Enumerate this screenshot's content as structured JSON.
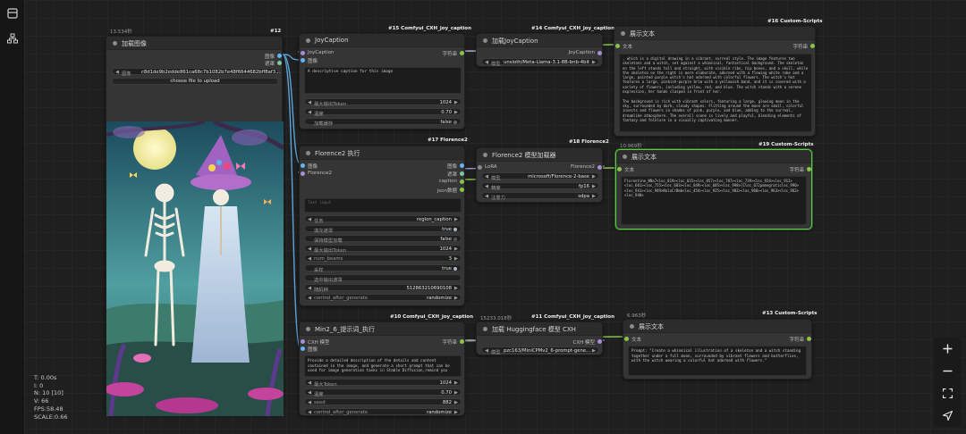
{
  "stats": {
    "t": "T: 0.00s",
    "i": "I: 0",
    "n": "N: 10 [10]",
    "v": "V: 66",
    "fps": "FPS:58.48",
    "scale": "SCALE:0.66"
  },
  "colors": {
    "canvas": "#1f1f1f",
    "node": "#353535",
    "title": "#2c2c2c",
    "image_port": "#64b5f6",
    "string_port": "#8bc34a",
    "model_port": "#b39ddb",
    "selected_border": "#5cc74a",
    "link_blue": "#5ba3d9",
    "link_green": "#8bc34a",
    "link_purple": "#a390d8"
  },
  "icons": {
    "sidebar": [
      "grid-icon",
      "tree-icon"
    ],
    "tools": [
      "plus-icon",
      "minus-icon",
      "fit-view-icon",
      "locate-icon"
    ]
  },
  "nodes": {
    "load_image": {
      "badge": "#12",
      "timer": "13.534秒",
      "title": "加载图像",
      "out_image": "图像",
      "out_mask": "遮罩",
      "image_label": "图像",
      "image_value": "c8d1de9b2edde861ca68c7b1082b7e48f6644682bff8af3...",
      "upload_label": "choose file to upload"
    },
    "joy_caption": {
      "badge": "#15 Comfyui_CXH_joy_caption",
      "title": "JoyCaption",
      "in_joy": "JoyCaption",
      "in_image": "图像",
      "out_string": "字符串",
      "prompt": "A descriptive caption for this image",
      "w_max_token_label": "最大输出Token",
      "w_max_token_value": "1024",
      "w_temp_label": "温度",
      "w_temp_value": "0.70",
      "w_cache_label": "加载缓存",
      "w_cache_value": "false"
    },
    "load_joy": {
      "badge": "#14 Comfyui_CXH_joy_caption",
      "title": "加载JoyCaption",
      "out_joy": "JoyCaption",
      "w_model_label": "模型",
      "w_model_value": "unsloth/Meta-Llama-3.1-8B-bnb-4bit"
    },
    "show_text_16": {
      "badge": "#16 Custom-Scripts",
      "title": "展示文本",
      "in_text": "文本",
      "out_string": "字符串",
      "text": ", which is a digital drawing in a vibrant, surreal style. The image features two skeletons and a witch, set against a whimsical, fantastical background. The skeleton on the left stands tall and straight, with visible ribs, hip bones, and a skull, while the skeleton on the right is more elaborate, adorned with a flowing white robe and a large, pointed purple witch's hat adorned with colorful flowers. The witch's hat features a large, pinkish-purple brim with a yellowish band, and it is covered with a variety of flowers, including yellow, red, and blue. The witch stands with a serene expression, her hands clasped in front of her.\n\nThe background is rich with vibrant colors, featuring a large, glowing moon in the sky, surrounded by dark, cloudy shapes. Flitting around the moon are small, colorful insects and flowers in shades of pink, purple, and blue, adding to the surreal, dreamlike atmosphere. The overall scene is lively and playful, blending elements of fantasy and folklore in a visually captivating manner."
    },
    "florence_run": {
      "badge": "#17 Florence2",
      "title": "Florence2 执行",
      "in_image": "图像",
      "in_florence": "Florence2",
      "out_image": "图像",
      "out_mask": "遮罩",
      "out_caption": "caption",
      "out_json": "json数据",
      "prompt_placeholder": "Text input",
      "w_task_label": "任务",
      "w_task_value": "region_caption",
      "w_fill_label": "填充遮罩",
      "w_fill_value": "true",
      "w_keep_label": "保持模型加载",
      "w_keep_value": "false",
      "w_max_token_label": "最大输出Token",
      "w_max_token_value": "1024",
      "w_beams_label": "num_beams",
      "w_beams_value": "3",
      "w_sample_label": "采样",
      "w_sample_value": "true",
      "w_output_mask_label": "选中输出遮罩",
      "w_output_mask_value": "",
      "w_seed_label": "随机种",
      "w_seed_value": "512863210690108",
      "w_control_label": "control_after_generate",
      "w_control_value": "randomize"
    },
    "florence_load": {
      "badge": "#18 Florence2",
      "title": "Florence2 模型加载器",
      "in_lora": "LoRA",
      "out_florence": "Florence2",
      "w_model_label": "模型",
      "w_model_value": "microsoft/Florence-2-base",
      "w_precision_label": "精度",
      "w_precision_value": "fp16",
      "w_attn_label": "注意力",
      "w_attn_value": "sdpa"
    },
    "show_text_19": {
      "badge": "#19 Custom-Scripts",
      "timer": "10.969秒",
      "title": "展示文本",
      "in_text": "文本",
      "out_string": "字符串",
      "text": "Florentine_NNa7<loc_819><loc_835><loc_857><loc_787><loc_739><loc_924><loc_912><loc_601><loc_755><loc_683><loc_849><loc_605><loc_998>[Cloc_672pomegraticloc_990><loc_941><loc_949>NaloCrBmb<loc_454><loc_925><loc_902><loc_960><loc_963><loc_982><loc_940>"
    },
    "minicpm_run": {
      "badge": "#10 Comfyui_CXH_joy_caption",
      "title": "Min2_6_提示词_执行",
      "in_cxh": "CXH 模型",
      "in_image": "图像",
      "out_string": "字符串",
      "prompt": "Provide a detailed description of the details and content contained in the image, and generate a short prompt that can be used for image generation tasks in Stable Diffusion,remind you",
      "w_max_token_label": "最大Token",
      "w_max_token_value": "1024",
      "w_temp_label": "温度",
      "w_temp_value": "0.70",
      "w_seed_label": "seed",
      "w_seed_value": "882",
      "w_control_label": "control_after_generate",
      "w_control_value": "randomize"
    },
    "hf_load": {
      "badge": "#11 Comfyui_CXH_joy_caption",
      "timer": "15233.018秒",
      "title": "加载 Huggingface 模型 CXH",
      "out_cxh": "CXH 模型",
      "w_model_label": "模型",
      "w_model_value": "pzc163/MiniCPMv2_6-prompt-gene..."
    },
    "show_text_13": {
      "badge": "#13 Custom-Scripts",
      "timer": "6.963秒",
      "title": "展示文本",
      "in_text": "文本",
      "out_string": "字符串",
      "text": "Prompt: \"Create a whimsical illustration of a skeleton and a witch standing together under a full moon, surrounded by vibrant flowers and butterflies, with the witch wearing a colorful hat adorned with flowers.\""
    }
  }
}
